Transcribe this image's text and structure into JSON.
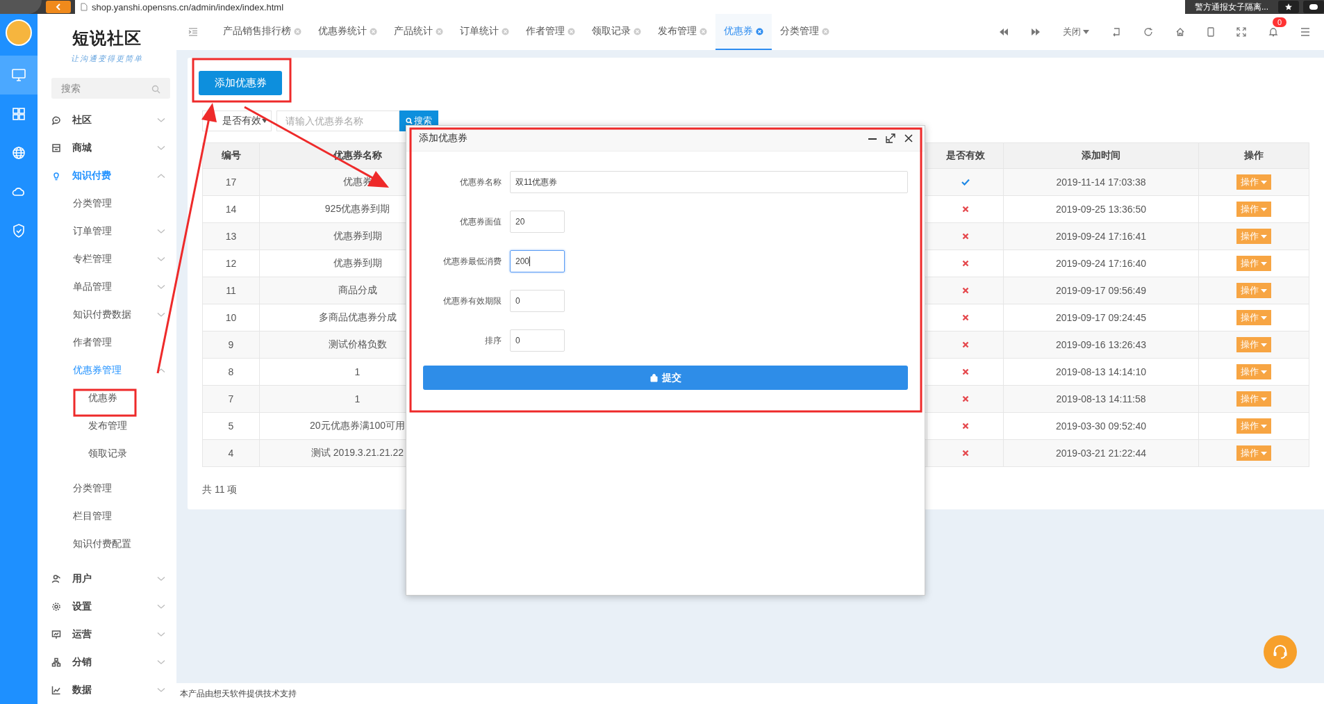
{
  "browser": {
    "url": "shop.yanshi.opensns.cn/admin/index/index.html",
    "news": "警方通报女子隔离..."
  },
  "brand": {
    "name": "短说社区",
    "slogan": "让沟通变得更简单"
  },
  "rail": [
    {
      "selected": true
    },
    {
      "selected": false
    },
    {
      "selected": false
    },
    {
      "selected": false
    },
    {
      "selected": false
    }
  ],
  "sidebar": {
    "search_placeholder": "搜索",
    "items": [
      {
        "label": "社区",
        "active": false,
        "expanded": false
      },
      {
        "label": "商城",
        "active": false,
        "expanded": false
      },
      {
        "label": "知识付费",
        "active": true,
        "expanded": true,
        "children": [
          {
            "label": "分类管理",
            "active": false
          },
          {
            "label": "订单管理",
            "active": false,
            "expanded": false
          },
          {
            "label": "专栏管理",
            "active": false,
            "expanded": false
          },
          {
            "label": "单品管理",
            "active": false,
            "expanded": false
          },
          {
            "label": "知识付费数据",
            "active": false,
            "expanded": false
          },
          {
            "label": "作者管理",
            "active": false
          },
          {
            "label": "优惠券管理",
            "active": true,
            "expanded": true,
            "children": [
              {
                "label": "优惠券",
                "active": false
              },
              {
                "label": "发布管理",
                "active": false
              },
              {
                "label": "领取记录",
                "active": false
              }
            ]
          },
          {
            "label": "分类管理",
            "active": false
          },
          {
            "label": "栏目管理",
            "active": false
          },
          {
            "label": "知识付费配置",
            "active": false
          }
        ]
      },
      {
        "label": "用户",
        "active": false,
        "expanded": false
      },
      {
        "label": "设置",
        "active": false,
        "expanded": false
      },
      {
        "label": "运营",
        "active": false,
        "expanded": false
      },
      {
        "label": "分销",
        "active": false,
        "expanded": false
      },
      {
        "label": "数据",
        "active": false,
        "expanded": false
      }
    ]
  },
  "tabs": [
    {
      "label": "产品销售排行榜",
      "selected": false
    },
    {
      "label": "优惠券统计",
      "selected": false
    },
    {
      "label": "产品统计",
      "selected": false
    },
    {
      "label": "订单统计",
      "selected": false
    },
    {
      "label": "作者管理",
      "selected": false
    },
    {
      "label": "领取记录",
      "selected": false
    },
    {
      "label": "发布管理",
      "selected": false
    },
    {
      "label": "优惠券",
      "selected": true
    },
    {
      "label": "分类管理",
      "selected": false
    }
  ],
  "toolbar": {
    "close_menu": "关闭",
    "notifications": "0"
  },
  "page": {
    "add_button": "添加优惠券",
    "filter": "是否有效",
    "search": {
      "placeholder": "请输入优惠券名称"
    },
    "search_button": "搜索",
    "columns": [
      "编号",
      "优惠券名称",
      "是否有效",
      "添加时间",
      "操作"
    ],
    "rows": [
      {
        "id": "17",
        "name": "优惠券",
        "valid": true,
        "added": "2019-11-14 17:03:38",
        "action": "操作"
      },
      {
        "id": "14",
        "name": "925优惠券到期",
        "valid": false,
        "added": "2019-09-25 13:36:50",
        "action": "操作"
      },
      {
        "id": "13",
        "name": "优惠券到期",
        "valid": false,
        "added": "2019-09-24 17:16:41",
        "action": "操作"
      },
      {
        "id": "12",
        "name": "优惠券到期",
        "valid": false,
        "added": "2019-09-24 17:16:40",
        "action": "操作"
      },
      {
        "id": "11",
        "name": "商品分成",
        "valid": false,
        "added": "2019-09-17 09:56:49",
        "action": "操作"
      },
      {
        "id": "10",
        "name": "多商品优惠券分成",
        "valid": false,
        "added": "2019-09-17 09:24:45",
        "action": "操作"
      },
      {
        "id": "9",
        "name": "测试价格负数",
        "valid": false,
        "added": "2019-09-16 13:26:43",
        "action": "操作"
      },
      {
        "id": "8",
        "name": "1",
        "valid": false,
        "added": "2019-08-13 14:14:10",
        "action": "操作"
      },
      {
        "id": "7",
        "name": "1",
        "valid": false,
        "added": "2019-08-13 14:11:58",
        "action": "操作"
      },
      {
        "id": "5",
        "name": "20元优惠券满100可用",
        "valid": false,
        "added": "2019-03-30 09:52:40",
        "action": "操作"
      },
      {
        "id": "4",
        "name": "测试 2019.3.21.21.22",
        "valid": false,
        "added": "2019-03-21 21:22:44",
        "action": "操作"
      }
    ],
    "total": "共 11 项"
  },
  "dialog": {
    "title": "添加优惠券",
    "fields": [
      {
        "label": "优惠券名称",
        "value": "双11优惠券",
        "kind": "text",
        "focused": false
      },
      {
        "label": "优惠券面值",
        "value": "20",
        "kind": "number",
        "focused": false
      },
      {
        "label": "优惠券最低消费",
        "value": "200",
        "kind": "number",
        "focused": true
      },
      {
        "label": "优惠券有效期限",
        "value": "0",
        "kind": "number",
        "focused": false
      },
      {
        "label": "排序",
        "value": "0",
        "kind": "number",
        "focused": false
      }
    ],
    "submit": "提交"
  },
  "footer": "本产品由想天软件提供技术支持"
}
